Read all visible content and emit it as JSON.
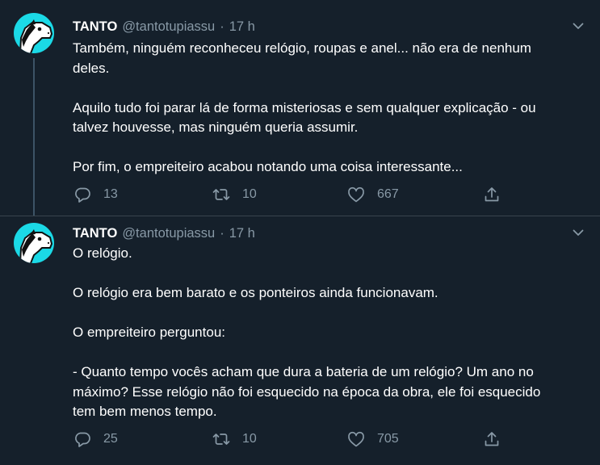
{
  "tweets": [
    {
      "author": {
        "name": "TANTO",
        "handle": "@tantotupiassu"
      },
      "separator": "·",
      "time": "17 h",
      "paragraphs": [
        "Também, ninguém reconheceu relógio, roupas e anel... não era de nenhum\ndeles.",
        "Aquilo tudo foi parar lá de forma misteriosas e sem qualquer explicação - ou\ntalvez houvesse, mas ninguém queria assumir.",
        "Por fim, o empreiteiro acabou notando uma coisa interessante..."
      ],
      "stats": {
        "replies": "13",
        "retweets": "10",
        "likes": "667"
      }
    },
    {
      "author": {
        "name": "TANTO",
        "handle": "@tantotupiassu"
      },
      "separator": "·",
      "time": "17 h",
      "paragraphs": [
        "O relógio.",
        "O relógio era bem barato e os ponteiros ainda funcionavam.",
        "O empreiteiro perguntou:",
        "- Quanto tempo vocês acham que dura a bateria de um relógio? Um ano no\nmáximo? Esse relógio não foi esquecido na época da obra, ele foi esquecido\ntem bem menos tempo."
      ],
      "stats": {
        "replies": "25",
        "retweets": "10",
        "likes": "705"
      }
    }
  ],
  "icons": {
    "reply": "reply-icon",
    "retweet": "retweet-icon",
    "like": "like-icon",
    "share": "share-icon",
    "caret": "chevron-down-icon",
    "avatar": "horse-avatar"
  },
  "colors": {
    "background": "#15202b",
    "text": "#ffffff",
    "secondary": "#8899a6",
    "divider": "#38444d",
    "avatar_bg": "#1bd9e6"
  }
}
